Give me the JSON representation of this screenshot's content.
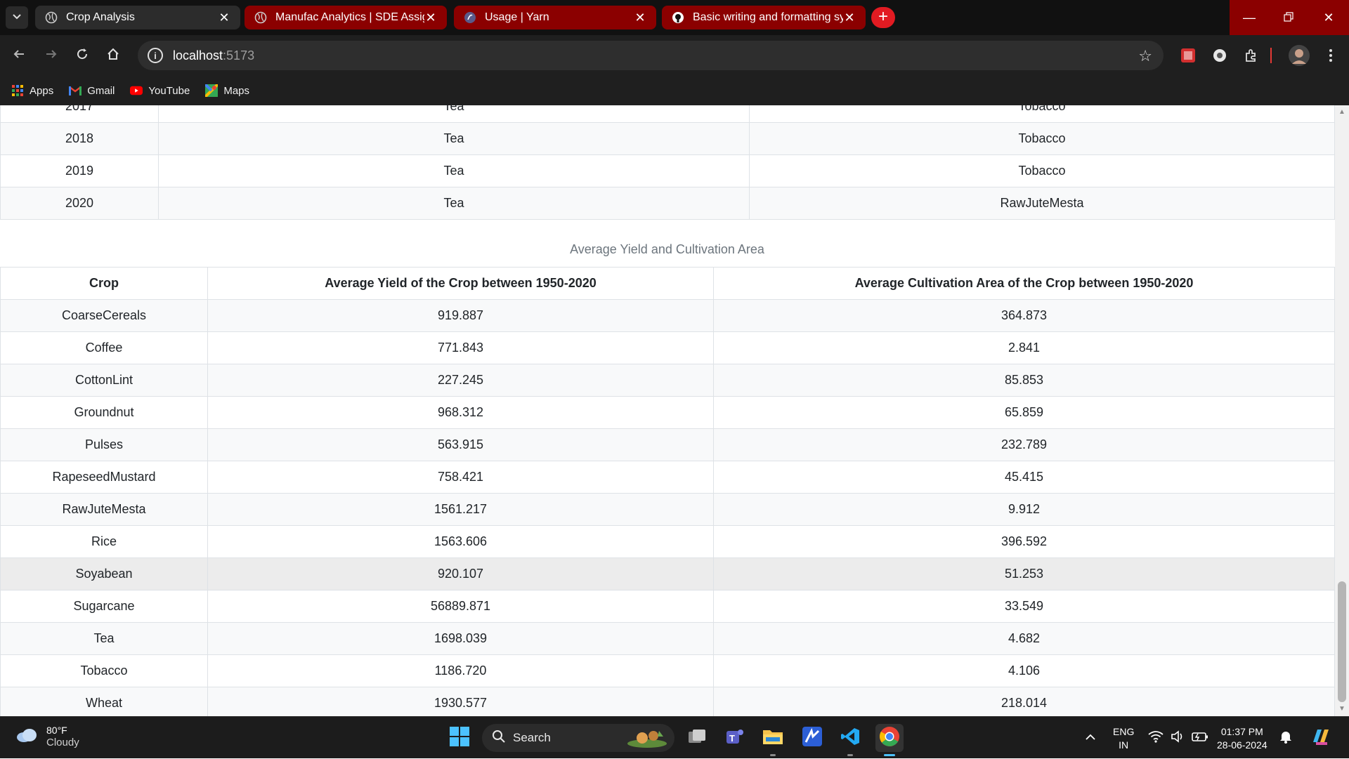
{
  "browser": {
    "tabs": [
      {
        "title": "Crop Analysis",
        "active": true
      },
      {
        "title": "Manufac Analytics | SDE Assignm",
        "active": false
      },
      {
        "title": "Usage | Yarn",
        "active": false
      },
      {
        "title": "Basic writing and formatting syn",
        "active": false
      }
    ],
    "address": {
      "host": "localhost",
      "port": ":5173"
    },
    "bookmarks": [
      "Apps",
      "Gmail",
      "YouTube",
      "Maps"
    ]
  },
  "page": {
    "yearly_table": {
      "rows": [
        {
          "year": "2018",
          "min_crop": "Tea",
          "max_crop": "Tobacco"
        },
        {
          "year": "2019",
          "min_crop": "Tea",
          "max_crop": "Tobacco"
        },
        {
          "year": "2020",
          "min_crop": "Tea",
          "max_crop": "RawJuteMesta"
        }
      ]
    },
    "average_table": {
      "caption": "Average Yield and Cultivation Area",
      "headers": [
        "Crop",
        "Average Yield of the Crop between 1950-2020",
        "Average Cultivation Area of the Crop between 1950-2020"
      ],
      "rows": [
        {
          "crop": "CoarseCereals",
          "yield": "919.887",
          "area": "364.873"
        },
        {
          "crop": "Coffee",
          "yield": "771.843",
          "area": "2.841"
        },
        {
          "crop": "CottonLint",
          "yield": "227.245",
          "area": "85.853"
        },
        {
          "crop": "Groundnut",
          "yield": "968.312",
          "area": "65.859"
        },
        {
          "crop": "Pulses",
          "yield": "563.915",
          "area": "232.789"
        },
        {
          "crop": "RapeseedMustard",
          "yield": "758.421",
          "area": "45.415"
        },
        {
          "crop": "RawJuteMesta",
          "yield": "1561.217",
          "area": "9.912"
        },
        {
          "crop": "Rice",
          "yield": "1563.606",
          "area": "396.592"
        },
        {
          "crop": "Soyabean",
          "yield": "920.107",
          "area": "51.253"
        },
        {
          "crop": "Sugarcane",
          "yield": "56889.871",
          "area": "33.549"
        },
        {
          "crop": "Tea",
          "yield": "1698.039",
          "area": "4.682"
        },
        {
          "crop": "Tobacco",
          "yield": "1186.720",
          "area": "4.106"
        },
        {
          "crop": "Wheat",
          "yield": "1930.577",
          "area": "218.014"
        }
      ]
    }
  },
  "taskbar": {
    "weather": {
      "temp": "80°F",
      "condition": "Cloudy"
    },
    "search_label": "Search",
    "language": {
      "lang": "ENG",
      "region": "IN"
    },
    "clock": {
      "time": "01:37 PM",
      "date": "28-06-2024"
    }
  },
  "colors": {
    "accent_red": "#8b0000",
    "new_tab_red": "#e21b22",
    "table_border": "#dee2e6",
    "stripe": "#f8f9fa"
  }
}
